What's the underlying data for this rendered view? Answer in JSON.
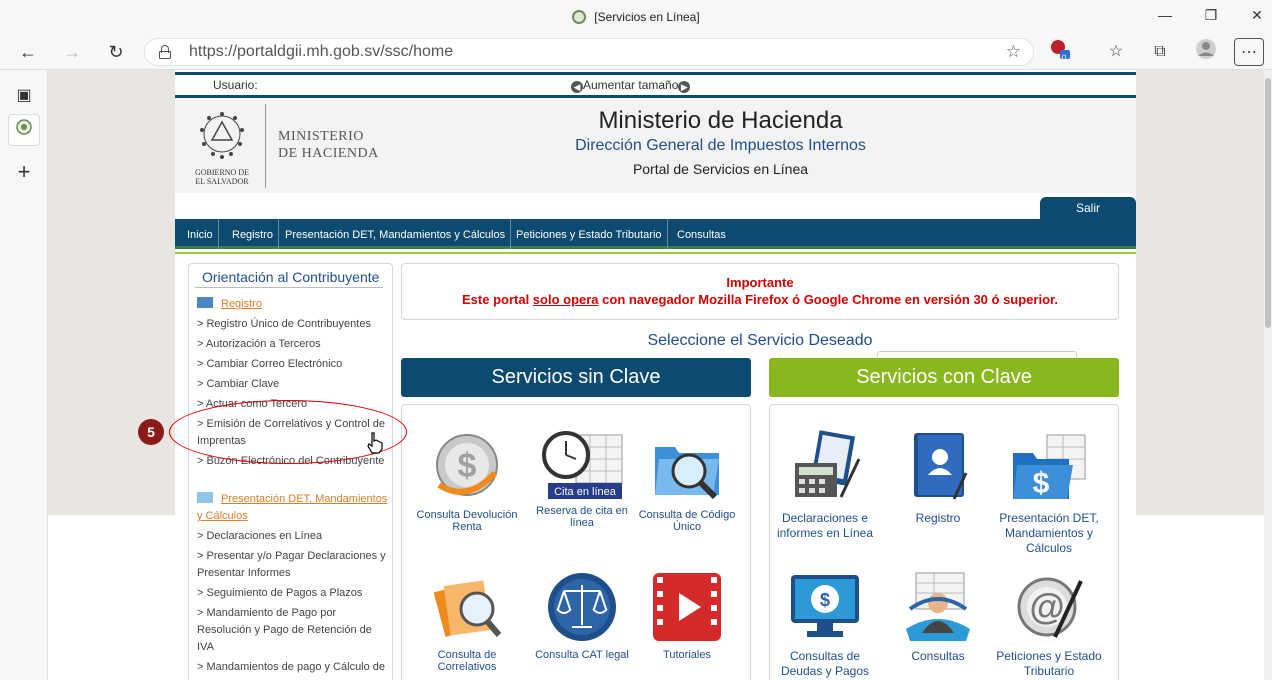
{
  "browser": {
    "tab_title": "[Servicios en Línea]",
    "url": "https://portaldgii.mh.gob.sv/ssc/home",
    "extension_badge": "0"
  },
  "site": {
    "user_label": "Usuario:",
    "font_size_label": "Aumentar tamaño",
    "ministry_logo_line1": "MINISTERIO",
    "ministry_logo_line2": "DE HACIENDA",
    "seal_text_line1": "GOBIERNO DE",
    "seal_text_line2": "EL SALVADOR",
    "title": "Ministerio de Hacienda",
    "subtitle": "Dirección General de Impuestos Internos",
    "portal": "Portal de Servicios en Línea",
    "logout": "Salir",
    "menu": [
      "Inicio",
      "Registro",
      "Presentación DET, Mandamientos y Cálculos",
      "Peticiones y Estado Tributario",
      "Consultas"
    ]
  },
  "left_panel": {
    "title": "Orientación al Contribuyente",
    "section1": "Registro",
    "items1": [
      "> Registro Único de Contribuyentes",
      "> Autorización a Terceros",
      "> Cambiar Correo Electrónico",
      "> Cambiar Clave",
      "> Actuar como Tercero",
      "> Emisión de Correlativos y Control de Imprentas",
      "> Buzón Electrónico del Contribuyente"
    ],
    "section2": "Presentación DET, Mandamientos y Cálculos",
    "items2": [
      "> Declaraciones en Línea",
      "> Presentar y/o Pagar Declaraciones y Presentar Informes",
      "> Seguimiento de Pagos a Plazos",
      "> Mandamiento de Pago por Resolución y Pago de Retención de IVA",
      "> Mandamientos de pago y Cálculo de"
    ]
  },
  "important": {
    "title": "Importante",
    "msg_before": "Este portal ",
    "msg_underlined": "solo opera",
    "msg_after": " con navegador Mozilla Firefox ó Google Chrome en versión 30 ó superior."
  },
  "services": {
    "select_title": "Seleccione el Servicio Deseado",
    "without_key": {
      "title": "Servicios sin Clave",
      "tiles": [
        "Consulta Devolución Renta",
        "Reserva de cita en línea",
        "Consulta de Código Único",
        "Consulta de Correlativos",
        "Consulta CAT legal",
        "Tutoriales"
      ],
      "cita_badge": "Cita en línea"
    },
    "with_key": {
      "title": "Servicios con Clave",
      "tiles": [
        "Declaraciones e informes en Línea",
        "Registro",
        "Presentación DET, Mandamientos y Cálculos",
        "Consultas de Deudas y Pagos",
        "Consultas",
        "Peticiones y Estado Tributario"
      ]
    }
  },
  "annotation": {
    "step_number": "5",
    "color": "#d00000"
  }
}
